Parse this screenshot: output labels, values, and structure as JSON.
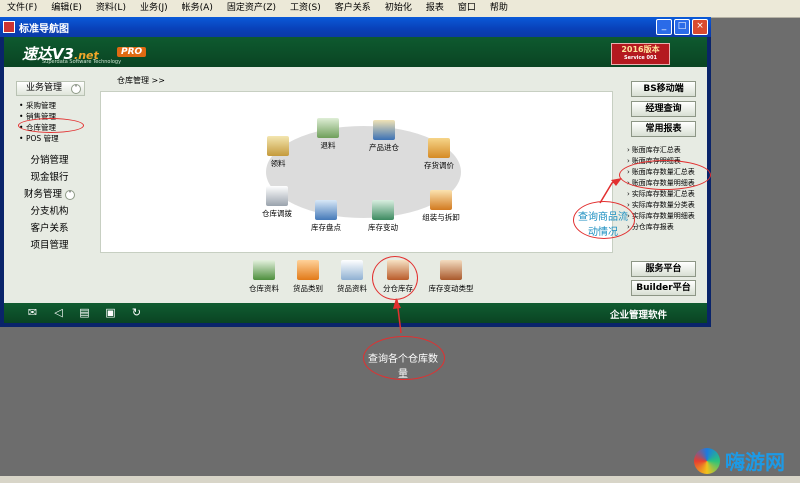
{
  "menu": [
    "文件(F)",
    "编辑(E)",
    "资料(L)",
    "业务(J)",
    "帐务(A)",
    "固定资产(Z)",
    "工资(S)",
    "客户关系",
    "初始化",
    "报表",
    "窗口",
    "帮助"
  ],
  "window": {
    "title": "标准导航图"
  },
  "brand": {
    "name": "速达V3",
    "suffix": ".net",
    "subtitle": "Superdata Software Technology",
    "edition": "PRO",
    "version": "2016版本",
    "version_sub": "Service 001"
  },
  "left_nav": {
    "group_title": "业务管理",
    "sub_items": [
      "采购管理",
      "销售管理",
      "仓库管理",
      "POS 管理"
    ],
    "main_items": [
      "分销管理",
      "现金银行",
      "财务管理",
      "分支机构",
      "客户关系",
      "项目管理"
    ]
  },
  "breadcrumb": "仓库管理  >>",
  "workflow": [
    "领料",
    "退料",
    "产品进仓",
    "存货调价",
    "仓库调拨",
    "库存盘点",
    "库存变动",
    "组装与拆卸"
  ],
  "bottom_items": [
    "仓库资料",
    "货品类别",
    "货品资料",
    "分仓库存",
    "库存变动类型"
  ],
  "right_buttons": {
    "mobile": "BS移动端",
    "query": "经理查询",
    "reports": "常用报表",
    "service": "服务平台",
    "builder": "Builder平台"
  },
  "report_links": [
    "账面库存汇总表",
    "账面库存明细表",
    "账面库存数量汇总表",
    "账面库存数量明细表",
    "实际库存数量汇总表",
    "实际库存数量分类表",
    "实际库存数量明细表",
    "分仓库存报表"
  ],
  "footer": {
    "right_text": "企业管理软件"
  },
  "annotations": {
    "right_note": "查询商品流动情况",
    "bottom_note": "查询各个仓库数量"
  },
  "watermark": {
    "text": "嗨游网"
  },
  "colors": {
    "header_green": "#0e5a2f",
    "annotation_red": "#e23030",
    "annotation_text": "#1a8ec0"
  }
}
